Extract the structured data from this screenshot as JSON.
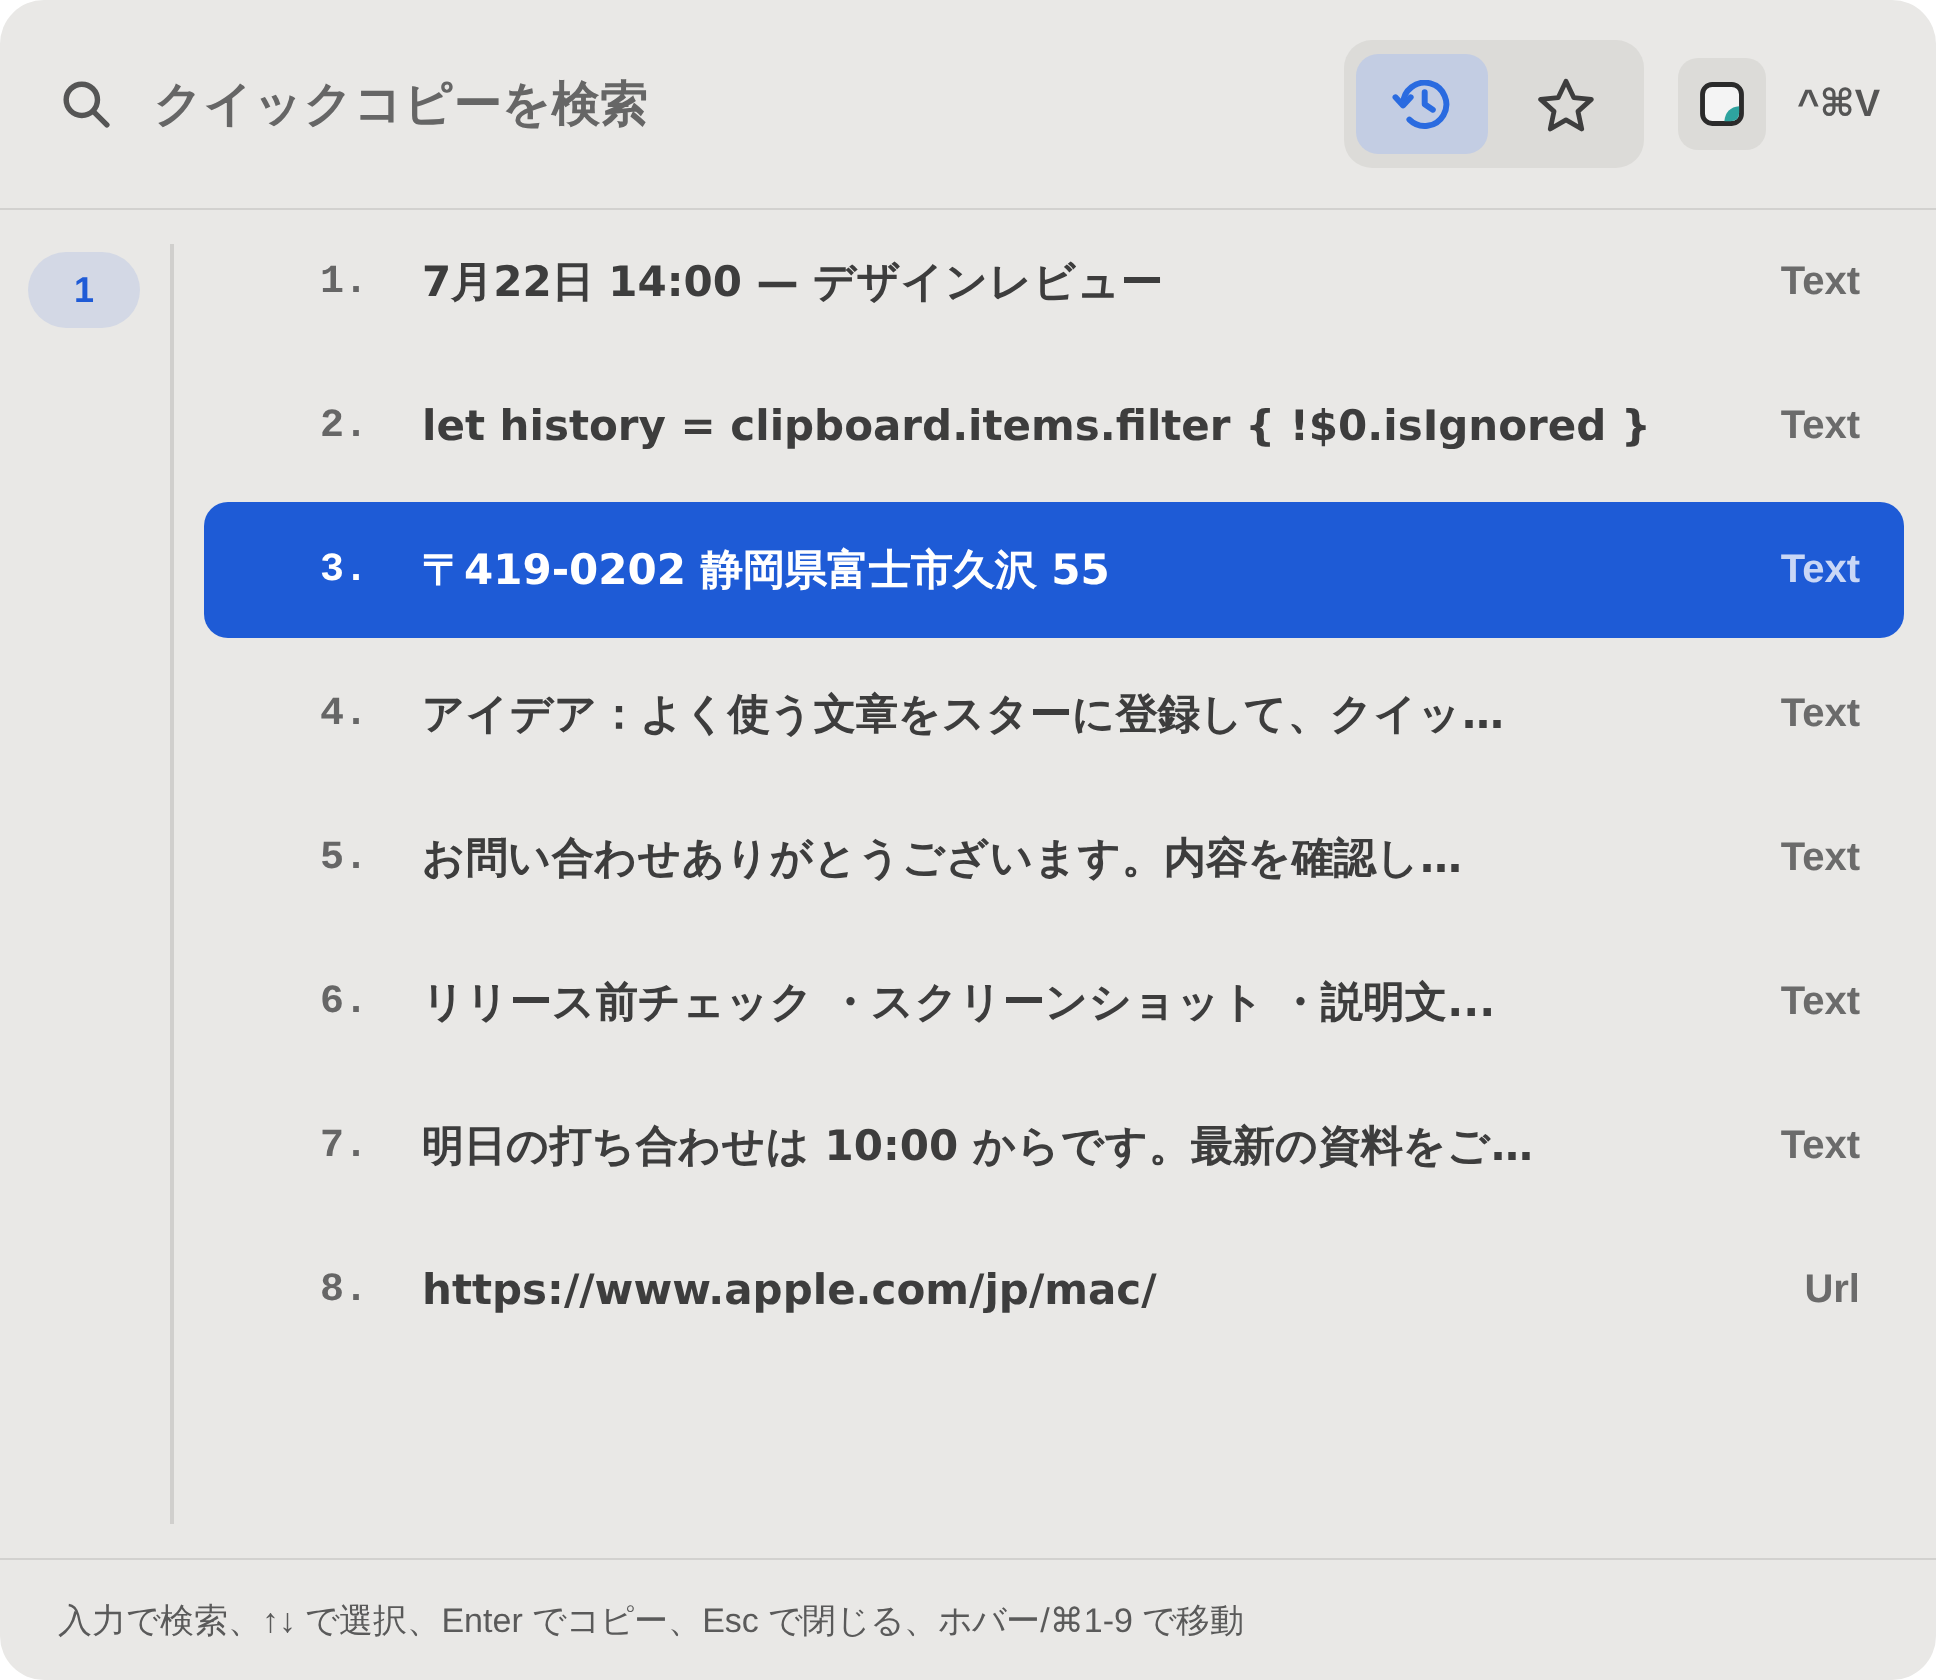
{
  "search": {
    "placeholder": "クイックコピーを検索"
  },
  "view_toggle": [
    {
      "kind": "history",
      "selected": true
    },
    {
      "kind": "favorites",
      "selected": false
    }
  ],
  "shortcut": "^⌘V",
  "pages": [
    {
      "label": "1",
      "selected": true
    }
  ],
  "items": [
    {
      "number": "1.",
      "text": "7月22日 14:00 — デザインレビュー",
      "type": "Text",
      "selected": false
    },
    {
      "number": "2.",
      "text": "let history = clipboard.items.filter { !$0.isIgnored }",
      "type": "Text",
      "selected": false
    },
    {
      "number": "3.",
      "text": "〒419-0202 静岡県富士市久沢 55",
      "type": "Text",
      "selected": true
    },
    {
      "number": "4.",
      "text": "アイデア：よく使う文章をスターに登録して、クイッ…",
      "type": "Text",
      "selected": false
    },
    {
      "number": "5.",
      "text": "お問い合わせありがとうございます。内容を確認し…",
      "type": "Text",
      "selected": false
    },
    {
      "number": "6.",
      "text": "リリース前チェック ・スクリーンショット ・説明文...",
      "type": "Text",
      "selected": false
    },
    {
      "number": "7.",
      "text": "明日の打ち合わせは 10:00 からです。最新の資料をご…",
      "type": "Text",
      "selected": false
    },
    {
      "number": "8.",
      "text": "https://www.apple.com/jp/mac/",
      "type": "Url",
      "selected": false
    }
  ],
  "footer": {
    "hint": "入力で検索、↑↓ で選択、Enter でコピー、Esc で閉じる、ホバー/⌘1-9 で移動"
  }
}
